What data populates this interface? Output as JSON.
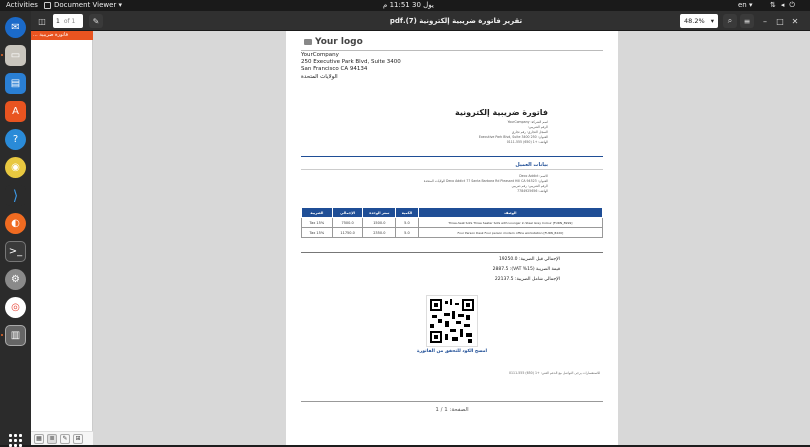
{
  "topbar": {
    "activities": "Activities",
    "app_name": "Document Viewer ▾",
    "clock": "يول 30  11:51 م",
    "lang": "en ▾"
  },
  "header": {
    "page_current": "1",
    "page_of": "of 1",
    "title": "تقرير فاتورة ضريبية إلكترونية (7).pdf",
    "zoom": "48.2%"
  },
  "sidebar": {
    "selected_item": "فاتورة ضريبية ..."
  },
  "doc": {
    "logo": "Your logo",
    "address": [
      "YourCompany",
      "250 Executive Park Blvd, Suite 3400",
      "San Francisco CA 94134",
      "الولايات المتحدة"
    ],
    "invoice_title": "فاتورة ضريبية إلكترونية",
    "seller_lines": [
      "اسم الشركة: YourCompany",
      "الرقم الضريبي:",
      "السجل التجاري: رقم تجاري",
      "العنوان: 250 Executive Park Blvd, Suite 3400",
      "الهاتف: +1 (650) 555-0111"
    ],
    "customer_header": "بيانات العميل",
    "customer_lines": [
      "الاسم: Deco Addict",
      "العنوان: Deco Addict 77 Santa Barbara Rd Pleasant Hill CA 94523 الولايات المتحدة",
      "الرقم الضريبي: رقم ضريبي",
      "الهاتف: 7784925656"
    ],
    "table_headers": [
      "الوصف",
      "الكمية",
      "سعر الوحدة",
      "الإجمالي",
      "الضريبة"
    ],
    "rows": [
      [
        "[FURN_8999] Three-Seat Sofa Three Seater Sofa with Lounger in Steel Grey Colour",
        "5.0",
        "1500.0",
        "7500.0",
        "Tax 15%"
      ],
      [
        "[FURN_8220] Four Person Desk Four person modern office workstation",
        "5.0",
        "2350.0",
        "11750.0",
        "Tax 15%"
      ]
    ],
    "totals": [
      "الإجمالي قبل الضريبة: 19250.0",
      "قيمة الضريبة (15% VAT): 2887.5",
      "الإجمالي شامل الضريبة: 22137.5"
    ],
    "scan_text": "امسح الكود للتحقق من الفاتورة",
    "contact": "للاستفسارات يرجى التواصل مع الدعم الفني: +1 (650) 555-0111",
    "page_number": "الصفحة: 1 / 1"
  }
}
